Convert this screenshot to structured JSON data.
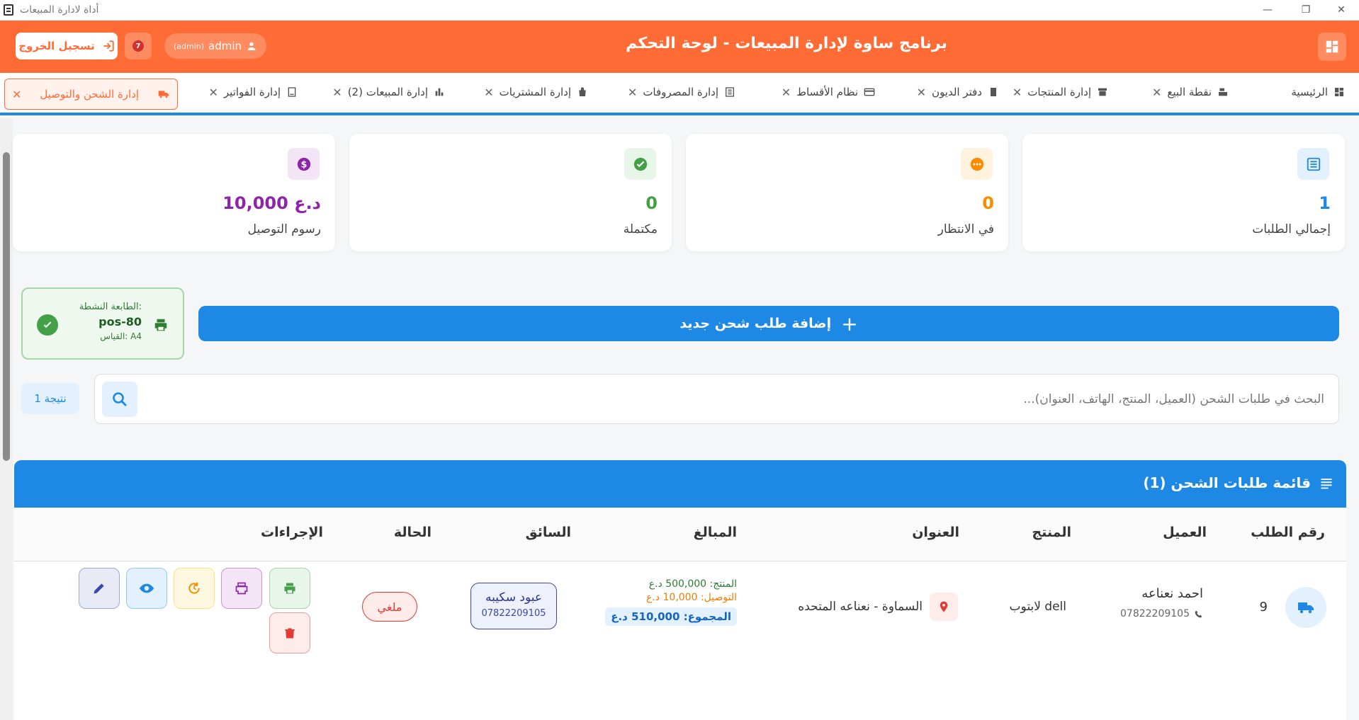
{
  "window": {
    "title": "أداة لادارة المبيعات"
  },
  "header": {
    "title": "برنامج ساوة لإدارة المبيعات - لوحة التحكم",
    "logout_label": "تسجيل الخروج",
    "notification_count": "7",
    "user": {
      "name": "admin",
      "role": "(admin)"
    }
  },
  "tabs": [
    {
      "label": "الرئيسية",
      "icon": "dashboard-icon",
      "closable": false
    },
    {
      "label": "نقطة البيع",
      "icon": "register-icon",
      "closable": true
    },
    {
      "label": "إدارة المنتجات",
      "icon": "archive-icon",
      "closable": true
    },
    {
      "label": "دفتر الديون",
      "icon": "book-icon",
      "closable": true
    },
    {
      "label": "نظام الأقساط",
      "icon": "card-icon",
      "closable": true
    },
    {
      "label": "إدارة المصروفات",
      "icon": "receipt-icon",
      "closable": true
    },
    {
      "label": "إدارة المشتريات",
      "icon": "bag-icon",
      "closable": true
    },
    {
      "label": "إدارة المبيعات (2)",
      "icon": "bar-chart-icon",
      "closable": true
    },
    {
      "label": "إدارة الفواتير",
      "icon": "invoice-icon",
      "closable": true
    },
    {
      "label": "إدارة الشحن والتوصيل",
      "icon": "truck-icon",
      "closable": true,
      "active": true
    }
  ],
  "stats": [
    {
      "label": "إجمالي الطلبات",
      "value": "1",
      "color": "#1e88e5",
      "icon": "list-icon"
    },
    {
      "label": "في الانتظار",
      "value": "0",
      "color": "#fb8c00",
      "icon": "pending-icon"
    },
    {
      "label": "مكتملة",
      "value": "0",
      "color": "#43a047",
      "icon": "check-icon"
    },
    {
      "label": "رسوم التوصيل",
      "value": "10,000 د.ع",
      "color": "#8e24aa",
      "icon": "dollar-icon"
    }
  ],
  "printer": {
    "label": "الطابعة النشطة:",
    "name": "pos-80",
    "size": "القياس: A4"
  },
  "add_button_label": "إضافة طلب شحن جديد",
  "search": {
    "placeholder": "البحث في طلبات الشحن (العميل، المنتج، الهاتف، العنوان)...",
    "value": "",
    "results": "1 نتيجة"
  },
  "table": {
    "title": "قائمة طلبات الشحن (1)",
    "columns": [
      "رقم الطلب",
      "العميل",
      "المنتج",
      "العنوان",
      "المبالغ",
      "السائق",
      "الحالة",
      "الإجراءات"
    ],
    "rows": [
      {
        "order_no": "9",
        "customer": "احمد نعناعه",
        "phone": "07822209105",
        "product": "لابتوب dell",
        "address": "السماوة - نعناعه المتحده",
        "amount_product": "المنتج: 500,000 د.ع",
        "amount_delivery": "التوصيل: 10,000 د.ع",
        "amount_total": "المجموع: 510,000 د.ع",
        "driver_name": "عبود سكيبه",
        "driver_phone": "07822209105",
        "status": "ملغي"
      }
    ]
  },
  "colors": {
    "header": "#ff6b35",
    "primary": "#1e88e5",
    "success": "#43a047",
    "danger": "#e53935"
  }
}
